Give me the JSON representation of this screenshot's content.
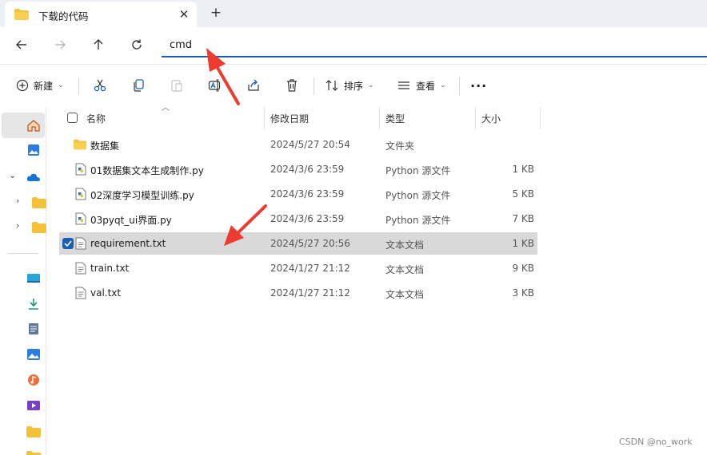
{
  "tab": {
    "title": "下载的代码",
    "close": "✕",
    "new_tab": "+"
  },
  "address": {
    "value": "cmd"
  },
  "toolbar": {
    "new_label": "新建",
    "sort_label": "排序",
    "view_label": "查看",
    "more": "···"
  },
  "columns": {
    "name": "名称",
    "date": "修改日期",
    "type": "类型",
    "size": "大小"
  },
  "files": [
    {
      "name": "数据集",
      "date": "2024/5/27 20:54",
      "type": "文件夹",
      "size": "",
      "icon": "folder-icon"
    },
    {
      "name": "01数据集文本生成制作.py",
      "date": "2024/3/6 23:59",
      "type": "Python 源文件",
      "size": "1 KB",
      "icon": "python-file-icon"
    },
    {
      "name": "02深度学习模型训练.py",
      "date": "2024/3/6 23:59",
      "type": "Python 源文件",
      "size": "5 KB",
      "icon": "python-file-icon"
    },
    {
      "name": "03pyqt_ui界面.py",
      "date": "2024/3/6 23:59",
      "type": "Python 源文件",
      "size": "7 KB",
      "icon": "python-file-icon"
    },
    {
      "name": "requirement.txt",
      "date": "2024/5/27 20:56",
      "type": "文本文档",
      "size": "1 KB",
      "icon": "text-file-icon",
      "selected": true
    },
    {
      "name": "train.txt",
      "date": "2024/1/27 21:12",
      "type": "文本文档",
      "size": "9 KB",
      "icon": "text-file-icon"
    },
    {
      "name": "val.txt",
      "date": "2024/1/27 21:12",
      "type": "文本文档",
      "size": "3 KB",
      "icon": "text-file-icon"
    }
  ],
  "watermark": "CSDN @no_work",
  "colors": {
    "accent": "#1a5fb4",
    "selected_row": "#d9d9d9",
    "folder": "#f3c23a",
    "arrow": "#ee3b30"
  }
}
